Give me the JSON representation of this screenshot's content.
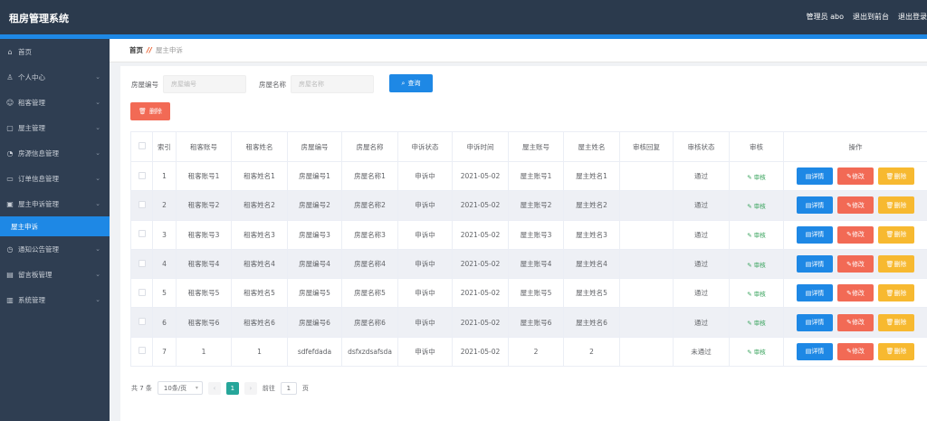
{
  "app": {
    "title": "租房管理系统"
  },
  "topbar": {
    "admin": "管理员 abo",
    "back_front": "退出到前台",
    "logout": "退出登录"
  },
  "sidebar": {
    "items": [
      {
        "label": "首页",
        "icon": "home-icon",
        "glyph": "⌂",
        "has_children": false
      },
      {
        "label": "个人中心",
        "icon": "user-icon",
        "glyph": "♙",
        "has_children": true
      },
      {
        "label": "租客管理",
        "icon": "tenant-icon",
        "glyph": "☺",
        "has_children": true
      },
      {
        "label": "屋主管理",
        "icon": "owner-icon",
        "glyph": "▢",
        "has_children": true
      },
      {
        "label": "房源信息管理",
        "icon": "house-icon",
        "glyph": "◔",
        "has_children": true
      },
      {
        "label": "订单信息管理",
        "icon": "order-icon",
        "glyph": "▭",
        "has_children": true
      },
      {
        "label": "屋主申诉管理",
        "icon": "appeal-icon",
        "glyph": "▣",
        "has_children": true
      }
    ],
    "active_sub": "屋主申诉",
    "items_after": [
      {
        "label": "通知公告管理",
        "icon": "notice-icon",
        "glyph": "◷",
        "has_children": true
      },
      {
        "label": "留言板管理",
        "icon": "message-icon",
        "glyph": "▤",
        "has_children": true
      },
      {
        "label": "系统管理",
        "icon": "settings-icon",
        "glyph": "▥",
        "has_children": true
      }
    ]
  },
  "breadcrumb": {
    "home": "首页",
    "current": "屋主申诉"
  },
  "search": {
    "house_no_label": "房屋编号",
    "house_no_placeholder": "房屋编号",
    "house_name_label": "房屋名称",
    "house_name_placeholder": "房屋名称",
    "query_label": "查询"
  },
  "toolbar": {
    "delete_label": "删除"
  },
  "table": {
    "headers": [
      "",
      "索引",
      "租客账号",
      "租客姓名",
      "房屋编号",
      "房屋名称",
      "申诉状态",
      "申诉时间",
      "屋主账号",
      "屋主姓名",
      "审核回复",
      "审核状态",
      "审核",
      "操作"
    ],
    "audit_link": "审核",
    "op_detail": "详情",
    "op_edit": "修改",
    "op_delete": "删除",
    "rows": [
      {
        "idx": "1",
        "tenant_acct": "租客账号1",
        "tenant_name": "租客姓名1",
        "house_no": "房屋编号1",
        "house_name": "房屋名称1",
        "status": "申诉中",
        "time": "2021-05-02",
        "owner_acct": "屋主账号1",
        "owner_name": "屋主姓名1",
        "reply": "",
        "audit_status": "通过"
      },
      {
        "idx": "2",
        "tenant_acct": "租客账号2",
        "tenant_name": "租客姓名2",
        "house_no": "房屋编号2",
        "house_name": "房屋名称2",
        "status": "申诉中",
        "time": "2021-05-02",
        "owner_acct": "屋主账号2",
        "owner_name": "屋主姓名2",
        "reply": "",
        "audit_status": "通过"
      },
      {
        "idx": "3",
        "tenant_acct": "租客账号3",
        "tenant_name": "租客姓名3",
        "house_no": "房屋编号3",
        "house_name": "房屋名称3",
        "status": "申诉中",
        "time": "2021-05-02",
        "owner_acct": "屋主账号3",
        "owner_name": "屋主姓名3",
        "reply": "",
        "audit_status": "通过"
      },
      {
        "idx": "4",
        "tenant_acct": "租客账号4",
        "tenant_name": "租客姓名4",
        "house_no": "房屋编号4",
        "house_name": "房屋名称4",
        "status": "申诉中",
        "time": "2021-05-02",
        "owner_acct": "屋主账号4",
        "owner_name": "屋主姓名4",
        "reply": "",
        "audit_status": "通过"
      },
      {
        "idx": "5",
        "tenant_acct": "租客账号5",
        "tenant_name": "租客姓名5",
        "house_no": "房屋编号5",
        "house_name": "房屋名称5",
        "status": "申诉中",
        "time": "2021-05-02",
        "owner_acct": "屋主账号5",
        "owner_name": "屋主姓名5",
        "reply": "",
        "audit_status": "通过"
      },
      {
        "idx": "6",
        "tenant_acct": "租客账号6",
        "tenant_name": "租客姓名6",
        "house_no": "房屋编号6",
        "house_name": "房屋名称6",
        "status": "申诉中",
        "time": "2021-05-02",
        "owner_acct": "屋主账号6",
        "owner_name": "屋主姓名6",
        "reply": "",
        "audit_status": "通过"
      },
      {
        "idx": "7",
        "tenant_acct": "1",
        "tenant_name": "1",
        "house_no": "sdfefdada",
        "house_name": "dsfxzdsafsda",
        "status": "申诉中",
        "time": "2021-05-02",
        "owner_acct": "2",
        "owner_name": "2",
        "reply": "",
        "audit_status": "未通过"
      }
    ]
  },
  "pager": {
    "total": "共 7 条",
    "page_size": "10条/页",
    "prev": "‹",
    "current": "1",
    "next": "›",
    "goto": "前往",
    "goto_value": "1",
    "page_unit": "页"
  },
  "colors": {
    "topbar": "#2b3a4d",
    "accent": "#1e88e5",
    "sidebar": "#2f3e52",
    "delete": "#f26a55",
    "warn": "#f7b930",
    "pager_active": "#26a69a"
  }
}
